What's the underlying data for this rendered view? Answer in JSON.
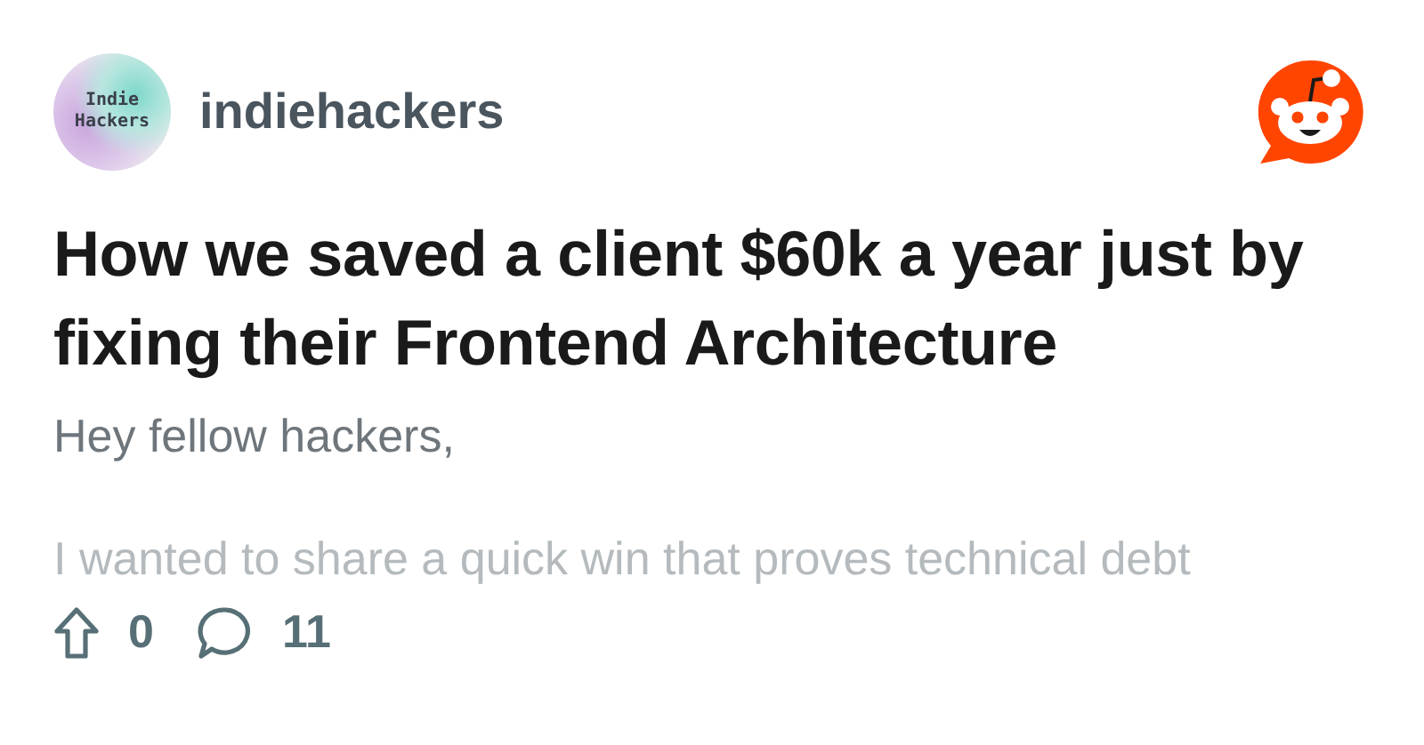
{
  "community": {
    "avatar_text": "Indie Hackers",
    "name": "indiehackers"
  },
  "post": {
    "title": "How we saved a client $60k a year just by fixing their Frontend Architecture",
    "greeting": "Hey fellow hackers,",
    "preview": "I wanted to share a quick win that proves technical debt"
  },
  "footer": {
    "upvotes": "0",
    "comments": "11"
  }
}
